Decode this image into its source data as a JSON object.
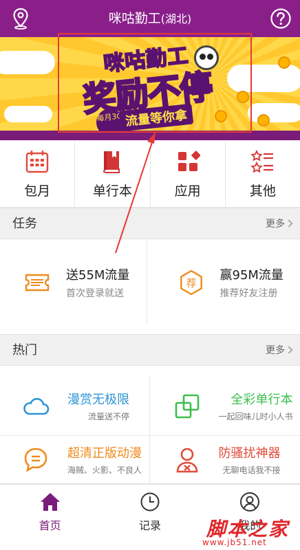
{
  "header": {
    "title": "咪咕勤工",
    "region": "(湖北)",
    "bg_color": "#8a1f8a",
    "left_icon": "location-pin-icon",
    "right_icon": "help-icon"
  },
  "banner": {
    "top_text": "咪咕勤工",
    "main_text": "奖励不停",
    "badge_text": "每月3G",
    "sub_text": "流量等你拿"
  },
  "categories": [
    {
      "label": "包月",
      "icon": "calendar-grid-icon",
      "color": "#e24a3b"
    },
    {
      "label": "单行本",
      "icon": "book-icon",
      "color": "#d43535"
    },
    {
      "label": "应用",
      "icon": "apps-icon",
      "color": "#d43535"
    },
    {
      "label": "其他",
      "icon": "star-list-icon",
      "color": "#d43535"
    }
  ],
  "tasks_section": {
    "title": "任务",
    "more": "更多"
  },
  "tasks": [
    {
      "title": "送55M流量",
      "desc": "首次登录就送",
      "icon": "ticket-icon"
    },
    {
      "title": "赢95M流量",
      "desc": "推荐好友注册",
      "icon": "recommend-hexagon-icon",
      "icon_text": "荐"
    }
  ],
  "hot_section": {
    "title": "热门",
    "more": "更多"
  },
  "hot": [
    {
      "title": "漫赏无极限",
      "desc": "流量送不停",
      "color": "#2f95d6",
      "icon": "cloud-icon"
    },
    {
      "title": "全彩单行本",
      "desc": "一起回味儿时小人书",
      "color": "#3cbf4e",
      "icon": "copy-squares-icon"
    },
    {
      "title": "超清正版动漫",
      "desc": "海贼、火影、不良人",
      "color": "#f08a1c",
      "icon": "chat-bubble-icon"
    },
    {
      "title": "防骚扰神器",
      "desc": "无聊电话我不接",
      "color": "#e24a3b",
      "icon": "user-block-icon"
    }
  ],
  "nav": [
    {
      "label": "首页",
      "icon": "home-icon",
      "active": true
    },
    {
      "label": "记录",
      "icon": "clock-icon",
      "active": false
    },
    {
      "label": "我的",
      "icon": "profile-icon",
      "active": false
    }
  ],
  "watermark": {
    "cn": "脚本之家",
    "url": "www.jb51.net"
  },
  "colors": {
    "brand": "#8a1f8a",
    "annotation": "#e53935"
  }
}
